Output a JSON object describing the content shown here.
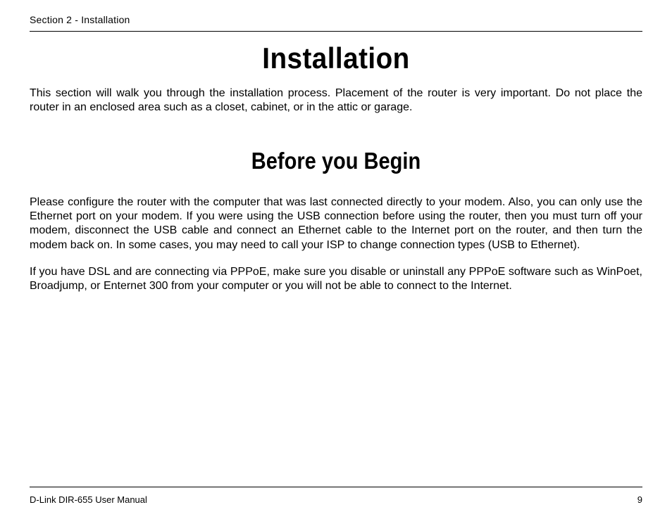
{
  "header": {
    "section_label": "Section 2 - Installation"
  },
  "content": {
    "title_main": "Installation",
    "intro_paragraph": "This section will walk you through the installation process. Placement of the router is very important. Do not place the router in an enclosed area such as a closet, cabinet, or in the attic or garage.",
    "title_sub": "Before you Begin",
    "paragraph_1": "Please configure the router with the computer that was last connected directly to your modem. Also, you can only use the Ethernet port on your modem. If you were using the USB connection before using the router, then you must turn off your modem, disconnect the USB cable and connect an Ethernet cable to the Internet port on the router, and then turn the modem back on. In some cases, you may need to call your ISP to change connection types (USB to Ethernet).",
    "paragraph_2": "If you have DSL and are connecting via PPPoE, make sure you disable or uninstall any PPPoE software such as WinPoet, Broadjump, or Enternet 300 from your computer or you will not be able to connect to the Internet."
  },
  "footer": {
    "manual_name": "D-Link DIR-655 User Manual",
    "page_number": "9"
  }
}
